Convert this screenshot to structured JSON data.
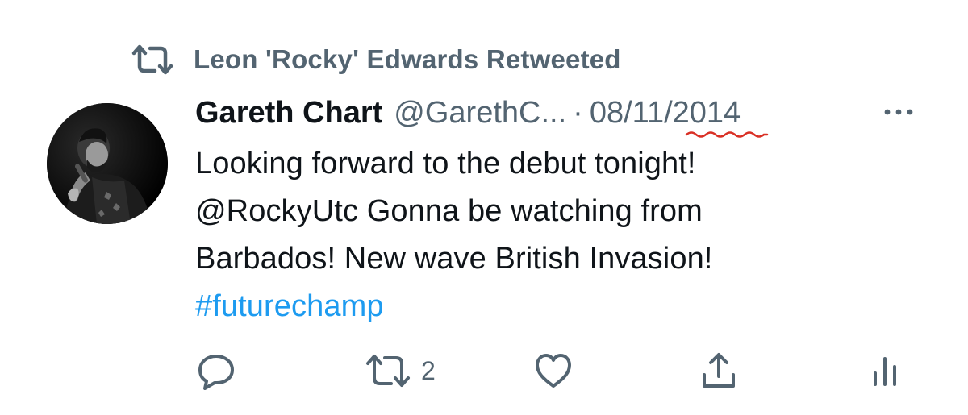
{
  "retweet_header": {
    "text": "Leon 'Rocky' Edwards Retweeted",
    "icon": "retweet-icon"
  },
  "tweet": {
    "author_name": "Gareth Chart",
    "author_handle": "@GarethC...",
    "separator": "·",
    "date": "08/11/2014",
    "body_lines": [
      "Looking forward to the debut tonight!",
      "@RockyUtc Gonna be watching from",
      "Barbados! New wave British Invasion!"
    ],
    "hashtag": "#futurechamp"
  },
  "actions": {
    "reply": {
      "icon": "reply-icon"
    },
    "retweet": {
      "icon": "retweet-icon",
      "count": "2"
    },
    "like": {
      "icon": "heart-icon"
    },
    "share": {
      "icon": "share-icon"
    },
    "analytics": {
      "icon": "analytics-icon"
    },
    "more": {
      "icon": "more-icon"
    }
  },
  "colors": {
    "muted": "#536471",
    "text": "#0f1419",
    "link": "#1d9bf0",
    "spellcheck_underline": "#d93025"
  }
}
